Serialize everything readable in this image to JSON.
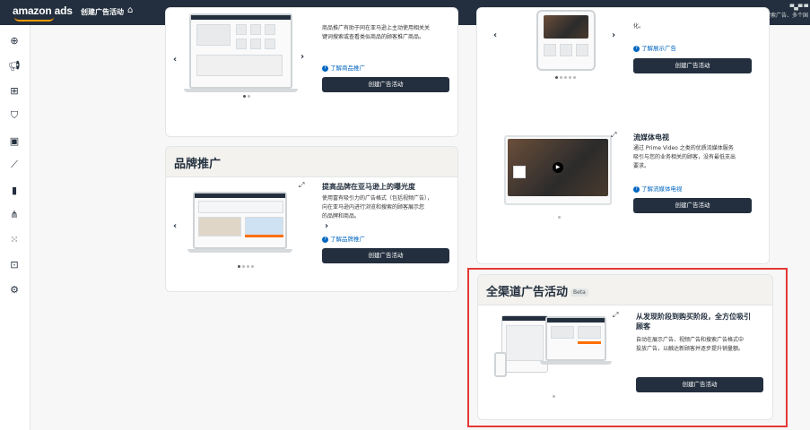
{
  "topbar": {
    "brand": "amazon ads",
    "title": "创建广告活动",
    "account_line1": "▀▄▀ ▀",
    "account_line2": "搜索广告、多个国"
  },
  "rail": [
    "plus-icon",
    "megaphone-icon",
    "grid-icon",
    "shield-icon",
    "image-icon",
    "line-chart-icon",
    "bar-chart-icon",
    "network-icon",
    "apps-icon",
    "briefcase-icon",
    "gear-icon"
  ],
  "product_card": {
    "desc": [
      "商品推广有助于同在亚马逊上主动使用相关关",
      "键词搜索或查看类似商品的顾客推广商品。"
    ],
    "learn": "了解商品推广",
    "button": "创建广告活动"
  },
  "brand_card": {
    "title": "品牌推广",
    "feature_title": "提高品牌在亚马逊上的曝光度",
    "desc": [
      "使用富有吸引力的广告格式（包括视频广告），",
      "向在亚马逊内进行浏览和搜索的顾客展示您",
      "的品牌和商品。"
    ],
    "learn": "了解品牌推广",
    "button": "创建广告活动"
  },
  "display_card": {
    "desc_tail": "化。",
    "learn": "了解展示广告",
    "button": "创建广告活动"
  },
  "streaming_card": {
    "title": "流媒体电视",
    "desc": [
      "通过 Prime Video 之类的优质流媒体服务",
      "吸引与您的业务相关的顾客，没有最低支出",
      "要求。"
    ],
    "learn": "了解流媒体电视",
    "button": "创建广告活动"
  },
  "omni_card": {
    "title": "全渠道广告活动",
    "badge": "Beta",
    "feature_title": [
      "从发现阶段到购买阶段，全方位吸引",
      "顾客"
    ],
    "desc": [
      "自动在展示广告、视频广告和搜索广告格式中",
      "投放广告，以触达新顾客并逐步提升销量额。"
    ],
    "button": "创建广告活动"
  },
  "colors": {
    "nav_bg": "#232f3e",
    "accent": "#ff9900",
    "link": "#0066c0",
    "highlight": "#e53935"
  }
}
